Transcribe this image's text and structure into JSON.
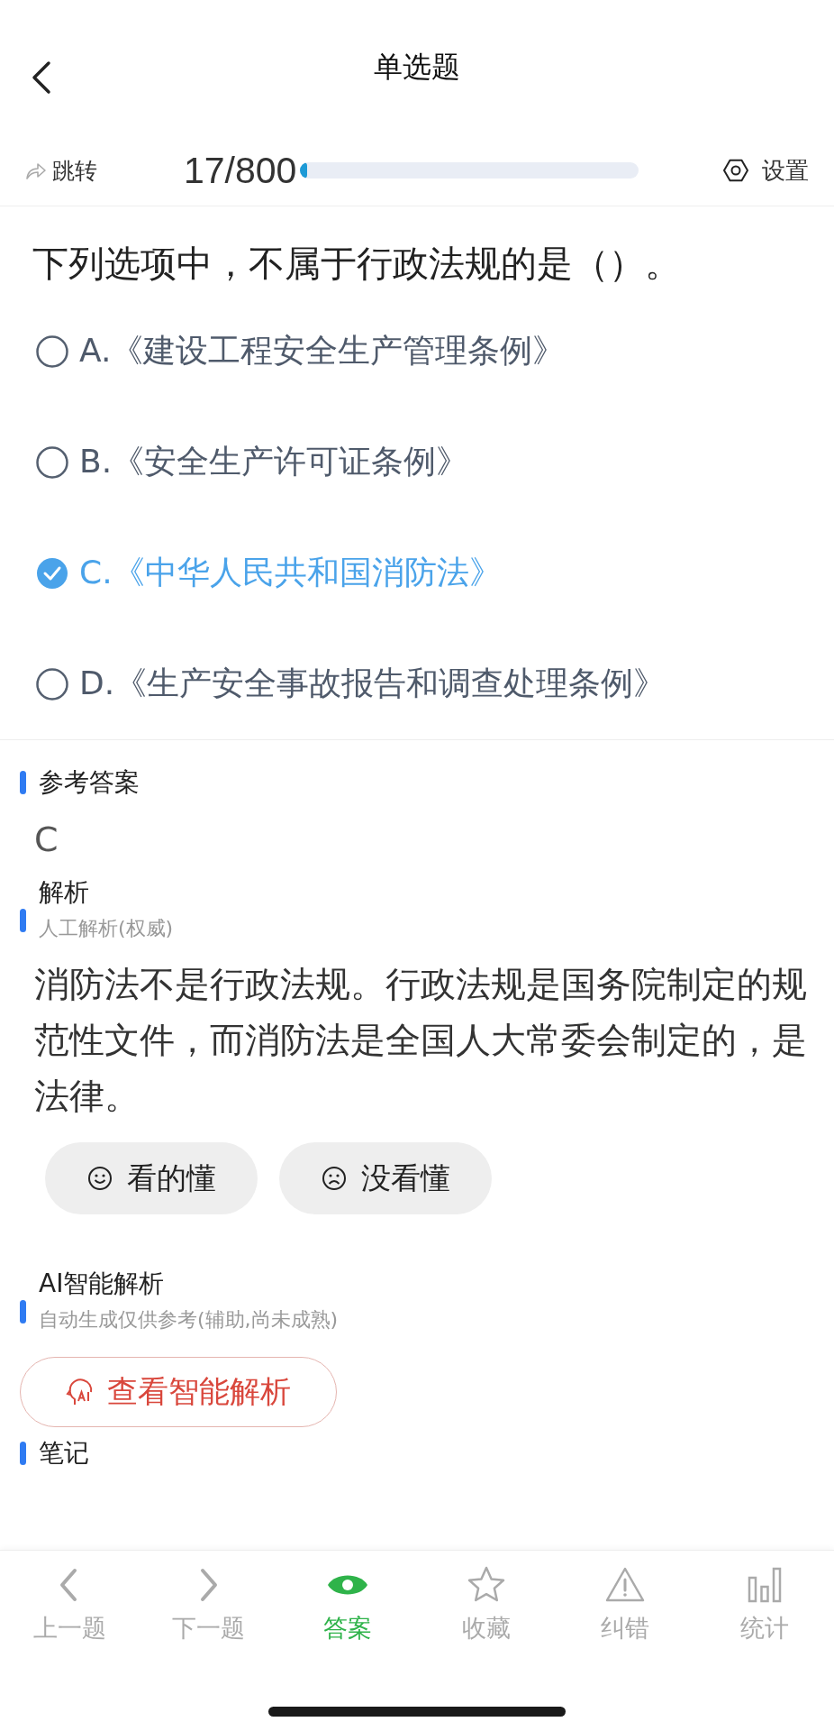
{
  "header": {
    "title": "单选题"
  },
  "toolbar": {
    "jump_label": "跳转",
    "counter": "17/800",
    "progress": {
      "level": 0.021
    },
    "settings_label": "设置"
  },
  "question": {
    "text": "下列选项中，不属于行政法规的是（）。",
    "options": [
      {
        "letter": "A.",
        "text": "《建设工程安全生产管理条例》",
        "selected": false
      },
      {
        "letter": "B.",
        "text": "《安全生产许可证条例》",
        "selected": false
      },
      {
        "letter": "C.",
        "text": "《中华人民共和国消防法》",
        "selected": true
      },
      {
        "letter": "D.",
        "text": "《生产安全事故报告和调查处理条例》",
        "selected": false
      }
    ]
  },
  "answer": {
    "heading": "参考答案",
    "value": "C"
  },
  "analysis": {
    "heading": "解析",
    "subtitle": "人工解析(权威)",
    "text": "消防法不是行政法规。行政法规是国务院制定的规范性文件，而消防法是全国人大常委会制定的，是法律。",
    "feedback": [
      {
        "kind": "happy",
        "label": "看的懂"
      },
      {
        "kind": "sad",
        "label": "没看懂"
      }
    ]
  },
  "ai_analysis": {
    "heading": "AI智能解析",
    "subtitle": "自动生成仅供参考(辅助,尚未成熟)",
    "button": "查看智能解析"
  },
  "notes": {
    "heading": "笔记"
  },
  "bottom_nav": [
    {
      "kind": "prev",
      "label": "上一题",
      "selected": false
    },
    {
      "kind": "next",
      "label": "下一题",
      "selected": false
    },
    {
      "kind": "eye",
      "label": "答案",
      "selected": true
    },
    {
      "kind": "star",
      "label": "收藏",
      "selected": false
    },
    {
      "kind": "warning",
      "label": "纠错",
      "selected": false
    },
    {
      "kind": "stats",
      "label": "统计",
      "selected": false
    }
  ]
}
